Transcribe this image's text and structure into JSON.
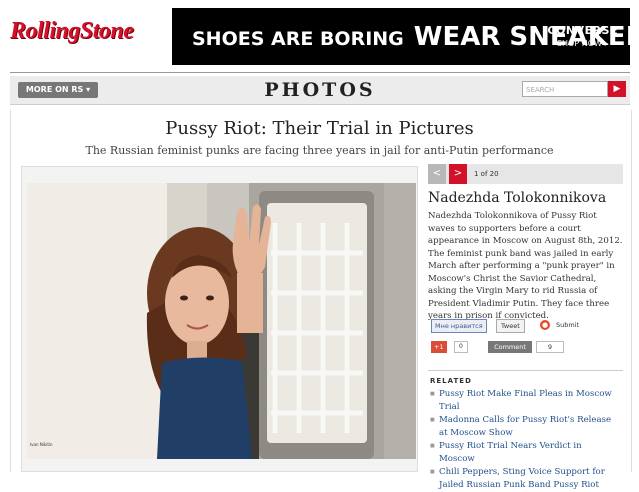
{
  "header": {
    "logo": "RollingStone",
    "ad": {
      "text_a": "SHOES ARE BORING",
      "text_b": "WEAR SNEAKERS",
      "brand": "CONVERSE",
      "cta": "SHOP NOW ▸"
    }
  },
  "nav": {
    "more_label": "MORE ON RS ▾",
    "section_title": "PHOTOS",
    "search_placeholder": "SEARCH",
    "search_button": "▶"
  },
  "article": {
    "headline": "Pussy Riot: Their Trial in Pictures",
    "subhead": "The Russian feminist punks are facing three years in jail for anti-Putin performance"
  },
  "gallery": {
    "prev": "<",
    "next": ">",
    "count": "1 of 20",
    "photo_credit": "Ivan Nikitin",
    "caption_title": "Nadezhda Tolokonnikova",
    "caption_body": "Nadezhda Tolokonnikova of Pussy Riot waves to supporters before a court appearance in Moscow on August 8th, 2012. The feminist punk band was jailed in early March after performing a \"punk prayer\" in Moscow's Christ the Savior Cathedral, asking the Virgin Mary to rid Russia of President Vladimir Putin. They face three years in prison if convicted."
  },
  "social": {
    "facebook_like": "Мне нравится",
    "tweet": "Tweet",
    "stumble": "Submit",
    "gplus": "+1",
    "gplus_count": "0",
    "comment_label": "Comment",
    "comment_count": "9"
  },
  "related": {
    "heading": "RELATED",
    "items": [
      "Pussy Riot Make Final Pleas in Moscow Trial",
      "Madonna Calls for Pussy Riot's Release at Moscow Show",
      "Pussy Riot Trial Nears Verdict in Moscow",
      "Chili Peppers, Sting Voice Support for Jailed Russian Punk Band Pussy Riot"
    ]
  },
  "colors": {
    "brand_red": "#d3112a",
    "link_blue": "#1f4f8a"
  }
}
